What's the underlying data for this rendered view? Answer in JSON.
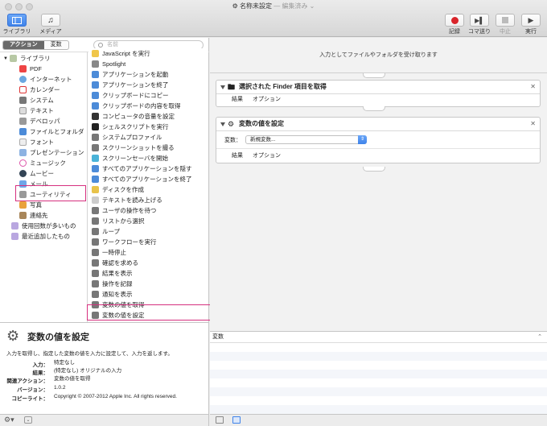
{
  "window": {
    "title": "名称未設定",
    "edited": "— 編集済み ⌄"
  },
  "toolbar": {
    "library_label": "ライブラリ",
    "media_label": "メディア",
    "record_label": "記録",
    "step_label": "コマ送り",
    "stop_label": "中止",
    "run_label": "実行"
  },
  "library": {
    "tab_actions": "アクション",
    "tab_variables": "変数",
    "search_placeholder": "名前",
    "categories": [
      "ライブラリ",
      "PDF",
      "インターネット",
      "カレンダー",
      "システム",
      "テキスト",
      "デベロッパ",
      "ファイルとフォルダ",
      "フォント",
      "プレゼンテーション",
      "ミュージック",
      "ムービー",
      "メール",
      "ユーティリティ",
      "写真",
      "連絡先",
      "使用回数が多いもの",
      "最近追加したもの"
    ],
    "actions": [
      "JavaScript を実行",
      "Spotlight",
      "アプリケーションを起動",
      "アプリケーションを終了",
      "クリップボードにコピー",
      "クリップボードの内容を取得",
      "コンピュータの音量を設定",
      "シェルスクリプトを実行",
      "システムプロファイル",
      "スクリーンショットを撮る",
      "スクリーンセーバを開始",
      "すべてのアプリケーションを隠す",
      "すべてのアプリケーションを終了",
      "ディスクを作成",
      "テキストを読み上げる",
      "ユーザの操作を待つ",
      "リストから選択",
      "ループ",
      "ワークフローを実行",
      "一時停止",
      "確認を求める",
      "結果を表示",
      "操作を記録",
      "通知を表示",
      "変数の値を取得",
      "変数の値を設定"
    ]
  },
  "description": {
    "title": "変数の値を設定",
    "text": "入力を取得し、指定した変数の値を入力に設定して、入力を返します。",
    "props": [
      {
        "k": "入力：",
        "v": "特定なし"
      },
      {
        "k": "結果：",
        "v": "(特定なし) オリジナルの入力"
      },
      {
        "k": "関連アクション：",
        "v": "変数の値を取得"
      },
      {
        "k": "バージョン：",
        "v": "1.0.2"
      },
      {
        "k": "コピーライト：",
        "v": "Copyright © 2007-2012 Apple Inc.  All rights reserved."
      }
    ]
  },
  "workflow": {
    "message": "入力としてファイルやフォルダを受け取ります",
    "card1": {
      "title": "選択された Finder 項目を取得",
      "results": "結果",
      "options": "オプション"
    },
    "card2": {
      "title": "変数の値を設定",
      "var_label": "変数：",
      "var_value": "新規変数...",
      "results": "結果",
      "options": "オプション"
    }
  },
  "log": {
    "header": "変数"
  },
  "colors": {
    "highlight": "#d6307f",
    "accent": "#3f83ea",
    "record": "#d9252b"
  }
}
